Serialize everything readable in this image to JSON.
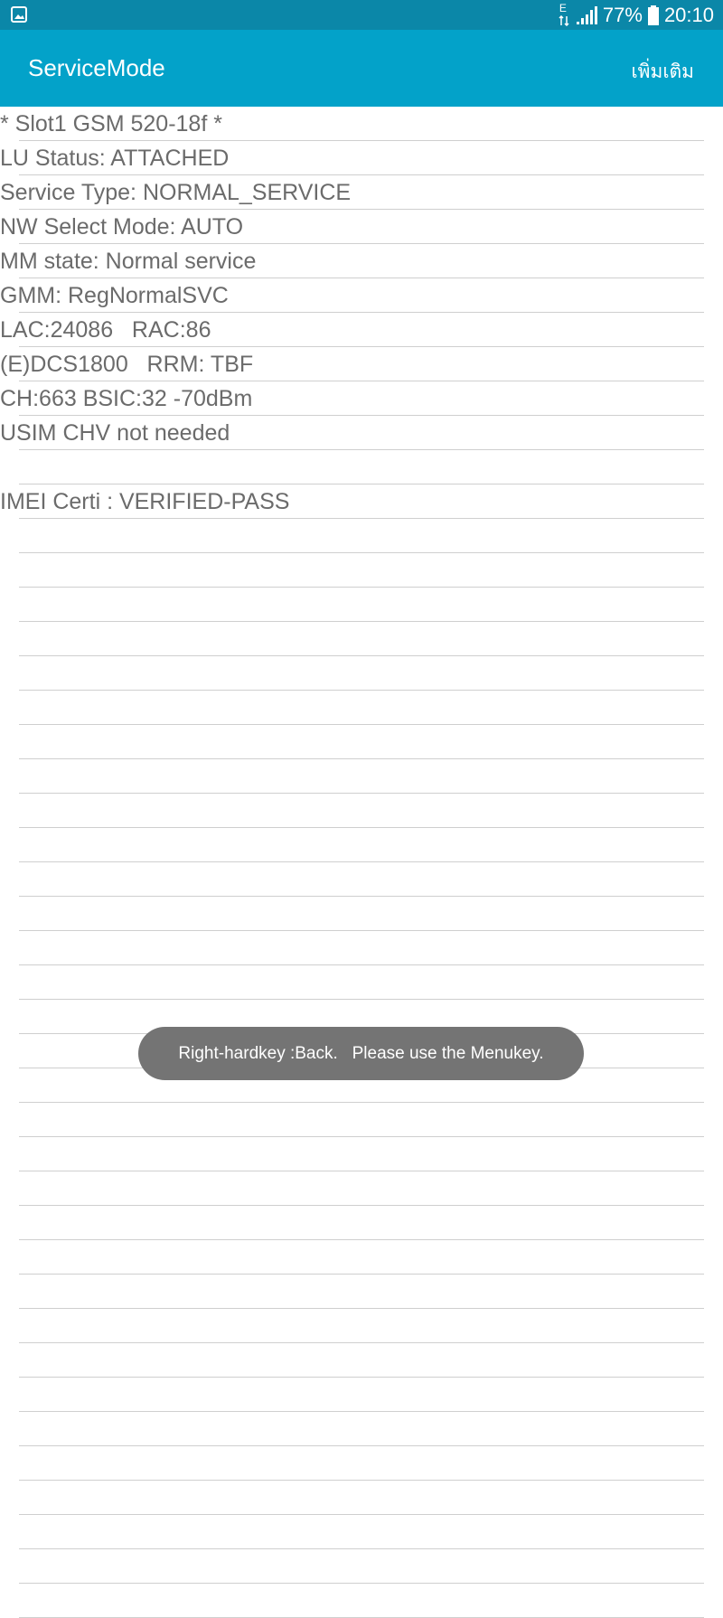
{
  "status_bar": {
    "network_type": "E",
    "battery_percent": "77%",
    "time": "20:10"
  },
  "app_bar": {
    "title": "ServiceMode",
    "more_label": "เพิ่มเติม"
  },
  "lines": [
    "* Slot1 GSM 520-18f *",
    "LU Status: ATTACHED",
    "Service Type: NORMAL_SERVICE",
    "NW Select Mode: AUTO",
    "MM state: Normal service",
    "GMM: RegNormalSVC",
    "LAC:24086   RAC:86",
    "(E)DCS1800   RRM: TBF",
    "CH:663 BSIC:32 -70dBm",
    "USIM CHV not needed",
    "",
    "IMEI Certi : VERIFIED-PASS",
    "",
    "",
    "",
    "",
    "",
    "",
    "",
    "",
    "",
    "",
    "",
    "",
    "",
    "",
    "",
    "",
    "",
    "",
    "",
    "",
    "",
    "",
    "",
    "",
    "",
    "",
    "",
    "",
    "",
    "",
    "",
    ""
  ],
  "toast": {
    "message": "Right-hardkey :Back.   Please use the Menukey."
  },
  "colors": {
    "status_bar_bg": "#0b87a8",
    "app_bar_bg": "#03a2c9",
    "text": "#6b6b6b",
    "toast_bg": "#747474"
  },
  "icons": {
    "status_left": "gallery-icon",
    "signal": "signal-icon",
    "battery": "battery-icon"
  }
}
